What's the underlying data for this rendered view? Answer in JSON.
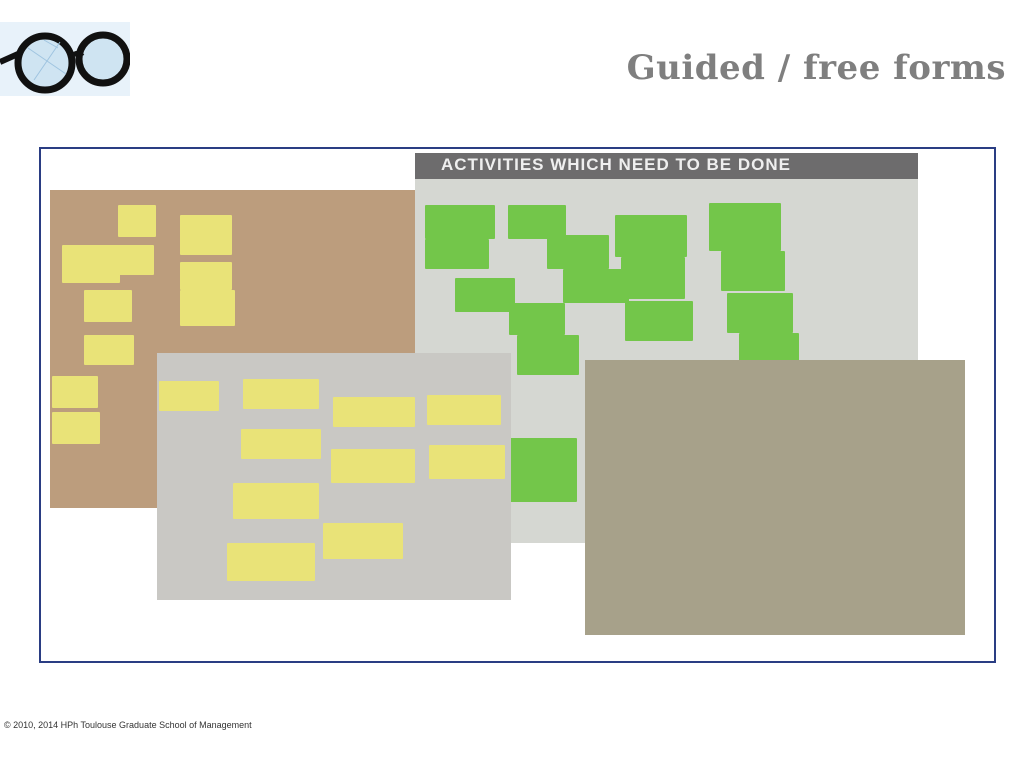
{
  "slide": {
    "title": "Guided / free forms",
    "copyright": "© 2010, 2014 HPh Toulouse Graduate School of Management"
  },
  "photos": {
    "activities": {
      "banner": "ACTIVITIES WHICH NEED TO BE DONE"
    }
  }
}
